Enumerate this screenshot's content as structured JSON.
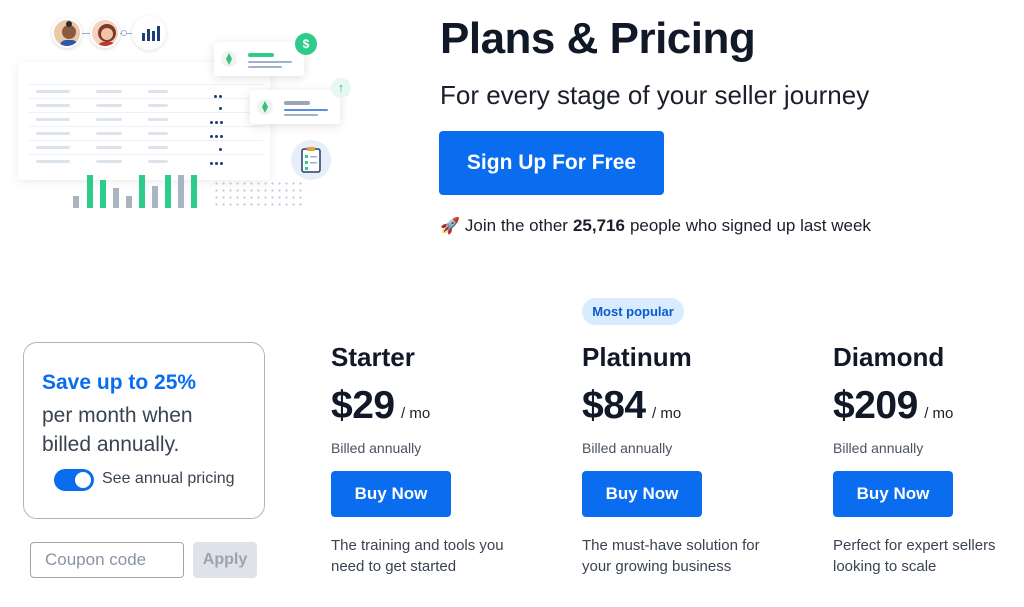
{
  "hero": {
    "title": "Plans & Pricing",
    "subtitle": "For every stage of your seller journey",
    "signup_label": "Sign Up For Free",
    "social_proof": {
      "icon": "rocket-icon",
      "prefix": "Join the other",
      "count": "25,716",
      "suffix": "people who signed up last week"
    }
  },
  "savings": {
    "headline": "Save up to 25%",
    "body": "per month when billed annually.",
    "toggle_label": "See annual pricing",
    "toggle_on": true
  },
  "coupon": {
    "placeholder": "Coupon code",
    "apply_label": "Apply"
  },
  "popular_badge": "Most popular",
  "plans": [
    {
      "name": "Starter",
      "price": "$29",
      "period": "/ mo",
      "billing": "Billed annually",
      "buy_label": "Buy Now",
      "description": "The training and tools you need to get started"
    },
    {
      "name": "Platinum",
      "price": "$84",
      "period": "/ mo",
      "billing": "Billed annually",
      "buy_label": "Buy Now",
      "description": "The must-have solution for your growing business"
    },
    {
      "name": "Diamond",
      "price": "$209",
      "period": "/ mo",
      "billing": "Billed annually",
      "buy_label": "Buy Now",
      "description": "Perfect for expert sellers looking to scale"
    }
  ],
  "colors": {
    "primary": "#0a6df0",
    "badge_bg": "#d9ebff",
    "accent_green": "#2ecc8a",
    "muted_bar": "#a9b4c2"
  }
}
